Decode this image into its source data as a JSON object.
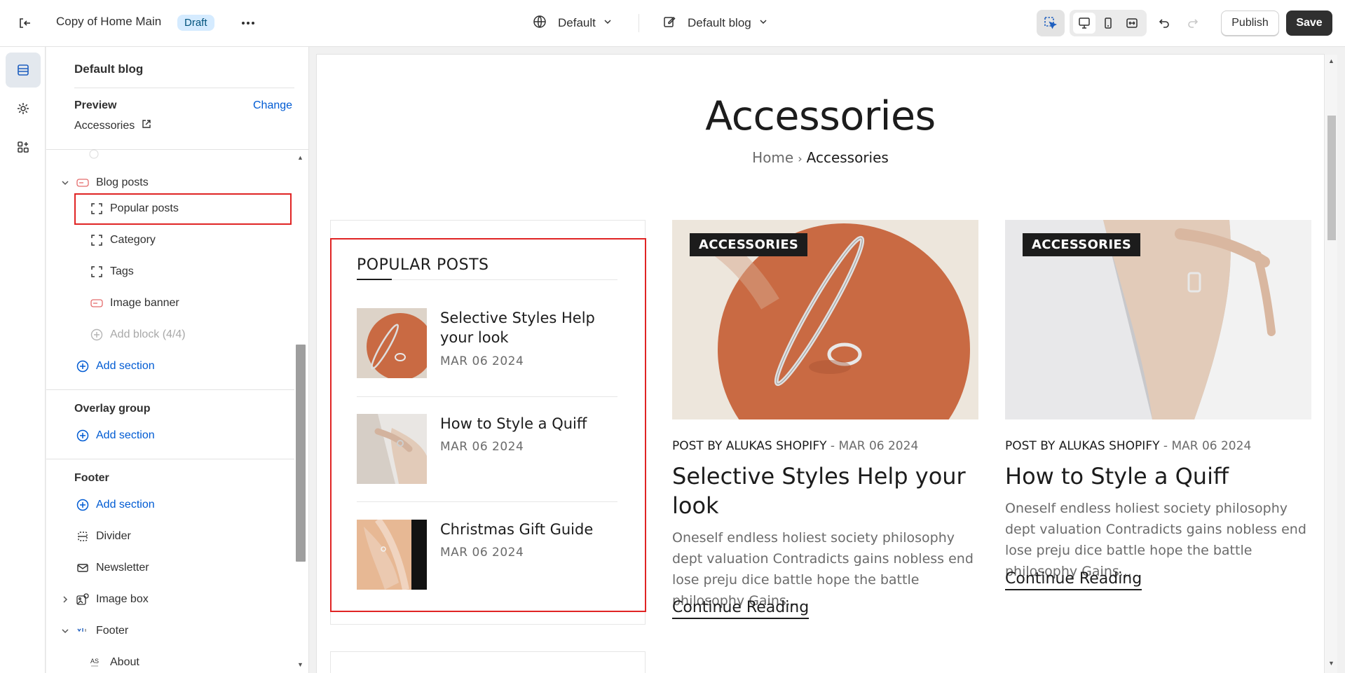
{
  "topbar": {
    "title": "Copy of Home Main",
    "badge": "Draft",
    "theme_label": "Default",
    "template_label": "Default blog",
    "publish_label": "Publish",
    "save_label": "Save"
  },
  "sidebar": {
    "header": "Default blog",
    "preview_label": "Preview",
    "change_label": "Change",
    "preview_value": "Accessories",
    "items": [
      {
        "label": "Blog posts"
      },
      {
        "label": "Popular posts"
      },
      {
        "label": "Category"
      },
      {
        "label": "Tags"
      },
      {
        "label": "Image banner"
      },
      {
        "label": "Add block (4/4)"
      },
      {
        "label": "Add section"
      }
    ],
    "overlay_group": {
      "title": "Overlay group",
      "add_label": "Add section"
    },
    "footer_group": {
      "title": "Footer",
      "add_label": "Add section",
      "items": [
        {
          "label": "Divider"
        },
        {
          "label": "Newsletter"
        },
        {
          "label": "Image box"
        },
        {
          "label": "Footer"
        },
        {
          "label": "About"
        }
      ]
    }
  },
  "preview": {
    "page_title": "Accessories",
    "breadcrumb_home": "Home",
    "breadcrumb_current": "Accessories",
    "popular_posts": {
      "title": "POPULAR POSTS",
      "posts": [
        {
          "title": "Selective Styles Help your look",
          "date": "MAR 06 2024"
        },
        {
          "title": "How to Style a Quiff",
          "date": "MAR 06 2024"
        },
        {
          "title": "Christmas Gift Guide",
          "date": "MAR 06 2024"
        }
      ]
    },
    "articles": [
      {
        "tag": "ACCESSORIES",
        "author": "POST BY ALUKAS SHOPIFY",
        "date": "- MAR 06 2024",
        "title": "Selective Styles Help your look",
        "excerpt": "Oneself endless holiest society philosophy dept valuation Contradicts gains nobless end lose preju dice battle hope the battle philosophy Gains...",
        "more": "Continue Reading"
      },
      {
        "tag": "ACCESSORIES",
        "author": "POST BY ALUKAS SHOPIFY",
        "date": "- MAR 06 2024",
        "title": "How to Style a Quiff",
        "excerpt": "Oneself endless holiest society philosophy dept valuation Contradicts gains nobless end lose preju dice battle hope the battle philosophy Gains...",
        "more": "Continue Reading"
      }
    ]
  },
  "colors": {
    "accent_link": "#005bd3",
    "selection_outline": "#e02424",
    "save_button": "#303030",
    "draft_badge": "#d5ebff"
  }
}
